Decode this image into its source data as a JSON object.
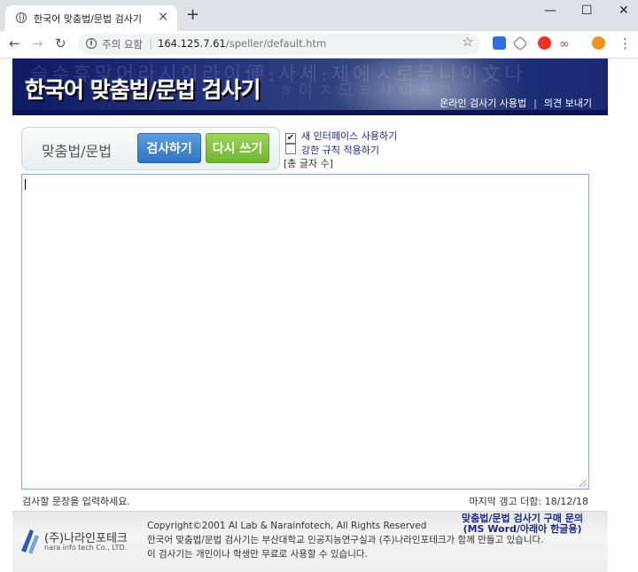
{
  "browser": {
    "tab_title": "한국어 맞춤법/문법 검사기",
    "tab_close": "×",
    "new_tab": "+",
    "window_controls": {
      "minimize": "—",
      "maximize": "☐",
      "close": "✕"
    },
    "nav": {
      "back": "←",
      "forward": "→",
      "reload": "↻"
    },
    "address": {
      "warning": "주의 요함",
      "separator": "|",
      "host": "164.125.7.61",
      "path": "/speller/default.htm"
    },
    "star": "☆",
    "extensions": [
      "chart-extension-icon",
      "tag-extension-icon",
      "opera-extension-icon",
      "infinity-extension-icon",
      "nima-extension-icon"
    ],
    "menu": "⋮"
  },
  "banner": {
    "title": "한국어 맞춤법/문법 검사기",
    "links": [
      "온라인 검사기 사용법",
      "의견 보내기"
    ],
    "divider": "|"
  },
  "tool": {
    "label": "맞춤법/문법",
    "check_button": "검사하기",
    "reset_button": "다시 쓰기"
  },
  "options": [
    {
      "label": "새 인터페이스 사용하기",
      "checked": true
    },
    {
      "label": "강한 규칙 적용하기",
      "checked": false
    }
  ],
  "char_count": "[총 글자 수]",
  "editor": {
    "value": ""
  },
  "hint": "검사할 문장을 입력하세요.",
  "last_updated": "마지막 갱고 더함: 18/12/18",
  "footer": {
    "company": "(주)나라인포테크",
    "company_en": "nara info tech Co., LTD.",
    "copyright": "Copyright©2001 AI Lab & Narainfotech, All Rights Reserved",
    "line1": "한국어 맞춤법/문법 검사기는 부산대학교 인공지능연구실과 (주)나라인포테크가 함께 만들고 있습니다.",
    "line2": "이 검사기는 개인이나 학생만 무료로 사용할 수 있습니다.",
    "buy_line1": "맞춤법/문법 검사기 구매 문의",
    "buy_line2": "(MS Word/아래아 한글용)"
  }
}
